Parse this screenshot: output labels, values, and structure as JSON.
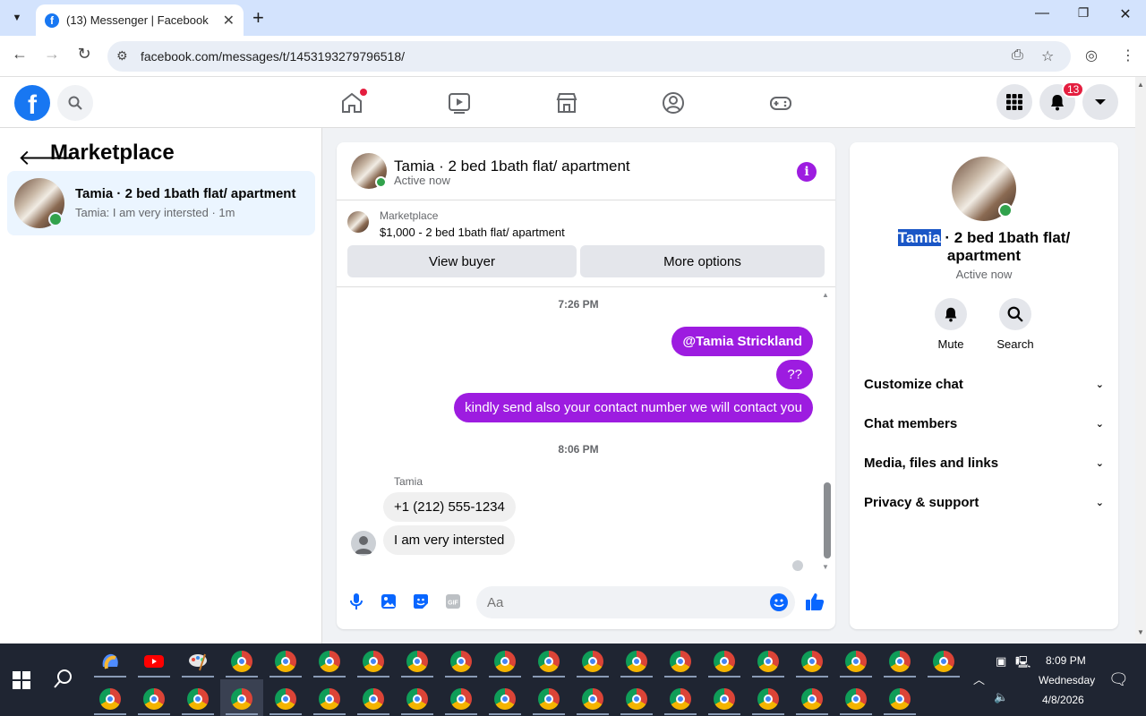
{
  "browser": {
    "tab_title": "(13) Messenger | Facebook",
    "url": "facebook.com/messages/t/1453193279796518/"
  },
  "fb_header": {
    "notification_count": "13"
  },
  "sidebar": {
    "title": "Marketplace",
    "conversation": {
      "name": "Tamia · 2 bed 1bath flat/ apartment",
      "preview": "Tamia: I am very intersted · 1m"
    }
  },
  "chat": {
    "title": "Tamia · 2 bed 1bath flat/ apartment",
    "status": "Active now",
    "marketplace_label": "Marketplace",
    "marketplace_item": "$1,000 - 2 bed 1bath flat/ apartment",
    "view_buyer_label": "View buyer",
    "more_options_label": "More options",
    "messages": {
      "time_1": "7:26 PM",
      "out_1": "@Tamia Strickland",
      "out_2": "??",
      "out_3": "kindly send also your contact number  we will contact you",
      "time_2": "8:06 PM",
      "sender_name": "Tamia",
      "in_1": "+1 (212) 555-1234",
      "in_2": "I am very intersted"
    },
    "composer_placeholder": "Aa"
  },
  "info_panel": {
    "name_highlighted": "Tamia",
    "name_rest": " · 2 bed 1bath flat/ apartment",
    "status": "Active now",
    "mute_label": "Mute",
    "search_label": "Search",
    "sections": [
      "Customize chat",
      "Chat members",
      "Media, files and links",
      "Privacy & support"
    ]
  },
  "taskbar": {
    "time": "8:09 PM",
    "day": "Wednesday",
    "date": "4/8/2026"
  },
  "colors": {
    "messenger_purple": "#9d1ce0",
    "fb_blue": "#1877f2",
    "online_green": "#31a24c"
  }
}
